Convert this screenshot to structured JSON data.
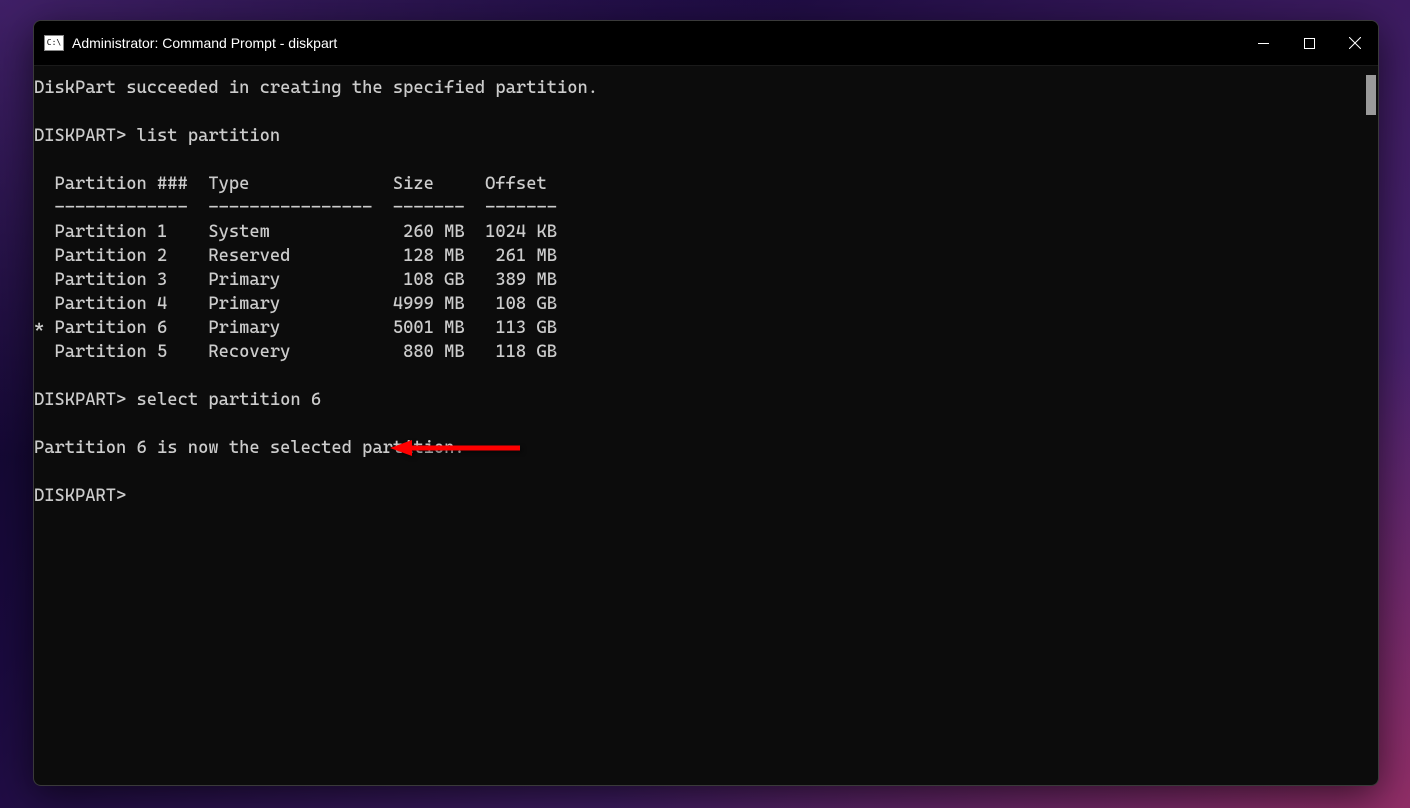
{
  "window": {
    "title": "Administrator: Command Prompt - diskpart",
    "icon_label": "C:\\"
  },
  "terminal": {
    "msg_created": "DiskPart succeeded in creating the specified partition.",
    "prompt1": "DISKPART> ",
    "cmd_list": "list partition",
    "table": {
      "header": "  Partition ###  Type              Size     Offset",
      "divider": "  -------------  ----------------  -------  -------",
      "rows": [
        "  Partition 1    System             260 MB  1024 KB",
        "  Partition 2    Reserved           128 MB   261 MB",
        "  Partition 3    Primary            108 GB   389 MB",
        "  Partition 4    Primary           4999 MB   108 GB",
        "* Partition 6    Primary           5001 MB   113 GB",
        "  Partition 5    Recovery           880 MB   118 GB"
      ]
    },
    "prompt2": "DISKPART> ",
    "cmd_select": "select partition 6",
    "msg_selected": "Partition 6 is now the selected partition.",
    "prompt3": "DISKPART>"
  },
  "annotation": {
    "color": "#ff0000"
  }
}
